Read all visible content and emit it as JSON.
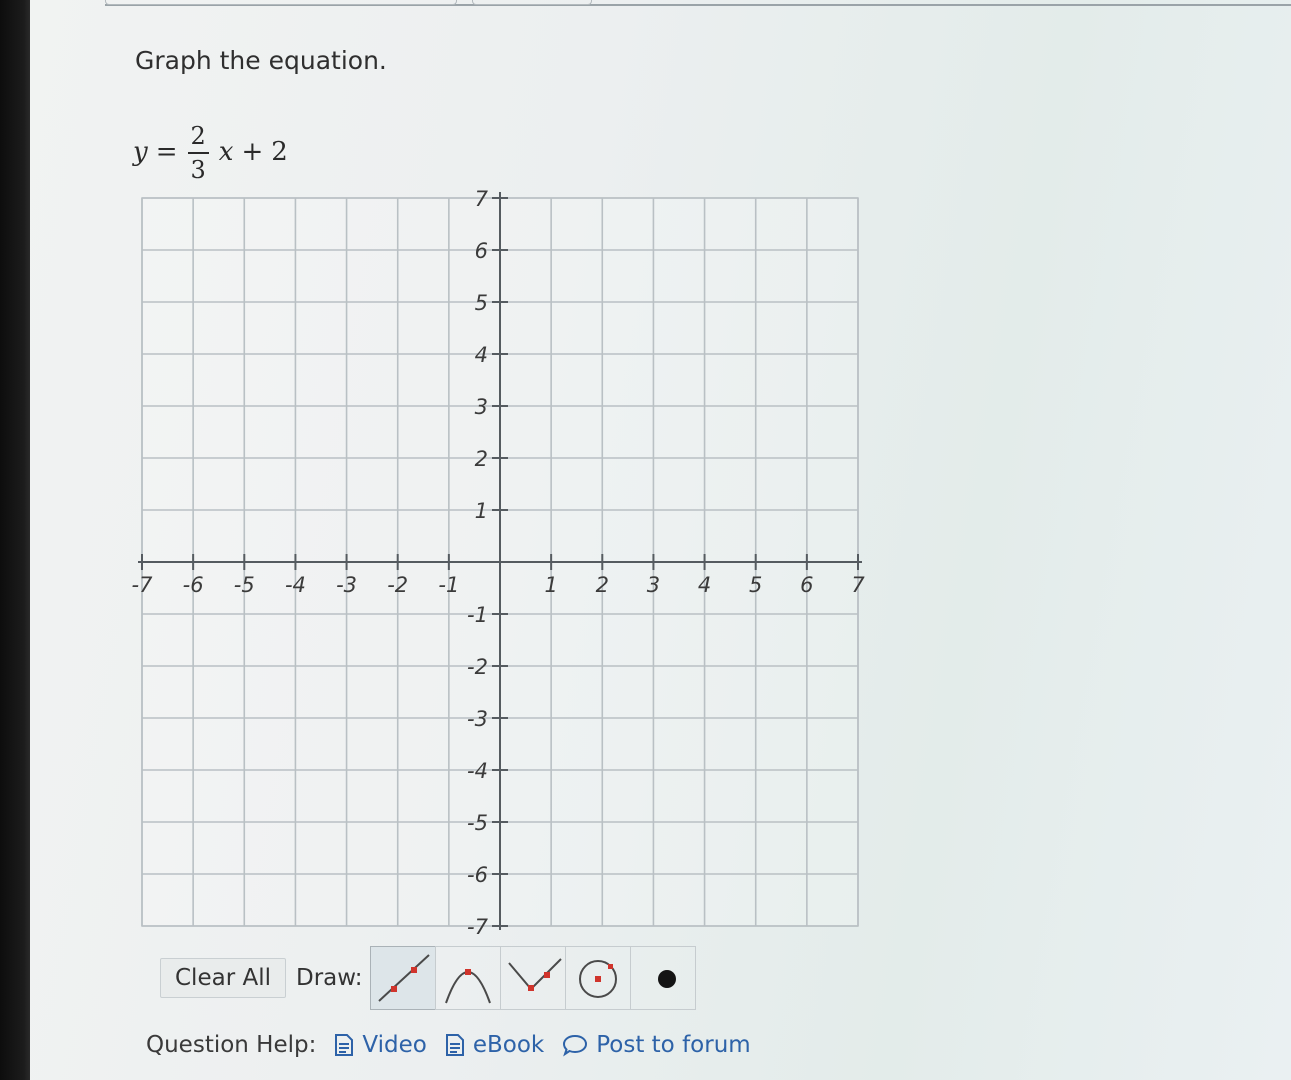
{
  "question": {
    "prompt": "Graph the equation.",
    "equation": {
      "lhs": "y",
      "equals": "=",
      "numerator": "2",
      "denominator": "3",
      "variable": "x",
      "plus": "+",
      "constant": "2"
    }
  },
  "chart_data": {
    "type": "grid",
    "xlim": [
      -7,
      7
    ],
    "ylim": [
      -7,
      7
    ],
    "grid": true,
    "x_ticks": [
      -7,
      -6,
      -5,
      -4,
      -3,
      -2,
      -1,
      1,
      2,
      3,
      4,
      5,
      6,
      7
    ],
    "y_ticks": [
      7,
      6,
      5,
      4,
      3,
      2,
      1,
      -1,
      -2,
      -3,
      -4,
      -5,
      -6,
      -7
    ],
    "x_tick_labels": [
      "-7",
      "-6",
      "-5",
      "-4",
      "-3",
      "-2",
      "-1",
      "1",
      "2",
      "3",
      "4",
      "5",
      "6",
      "7"
    ],
    "y_tick_labels": [
      "7",
      "6",
      "5",
      "4",
      "3",
      "2",
      "1",
      "-1",
      "-2",
      "-3",
      "-4",
      "-5",
      "-6",
      "-7"
    ],
    "series": []
  },
  "controls": {
    "clear_label": "Clear All",
    "draw_label": "Draw:",
    "tools": [
      {
        "name": "line-tool",
        "icon": "line-icon",
        "active": true
      },
      {
        "name": "parabola-down-tool",
        "icon": "parabola-down-icon",
        "active": false
      },
      {
        "name": "vee-tool",
        "icon": "vee-icon",
        "active": false
      },
      {
        "name": "circle-tool",
        "icon": "circle-icon",
        "active": false
      },
      {
        "name": "dot-tool",
        "icon": "dot-icon",
        "active": false
      }
    ]
  },
  "help": {
    "label": "Question Help:",
    "links": [
      {
        "name": "video-link",
        "icon": "document-icon",
        "label": "Video"
      },
      {
        "name": "ebook-link",
        "icon": "document-icon",
        "label": "eBook"
      },
      {
        "name": "forum-link",
        "icon": "speech-bubble-icon",
        "label": "Post to forum"
      }
    ]
  },
  "colors": {
    "grid": "#b9c0c4",
    "axis": "#555b60",
    "label": "#3b3b3b",
    "tool_red": "#d0342c",
    "link": "#2d62a8"
  }
}
